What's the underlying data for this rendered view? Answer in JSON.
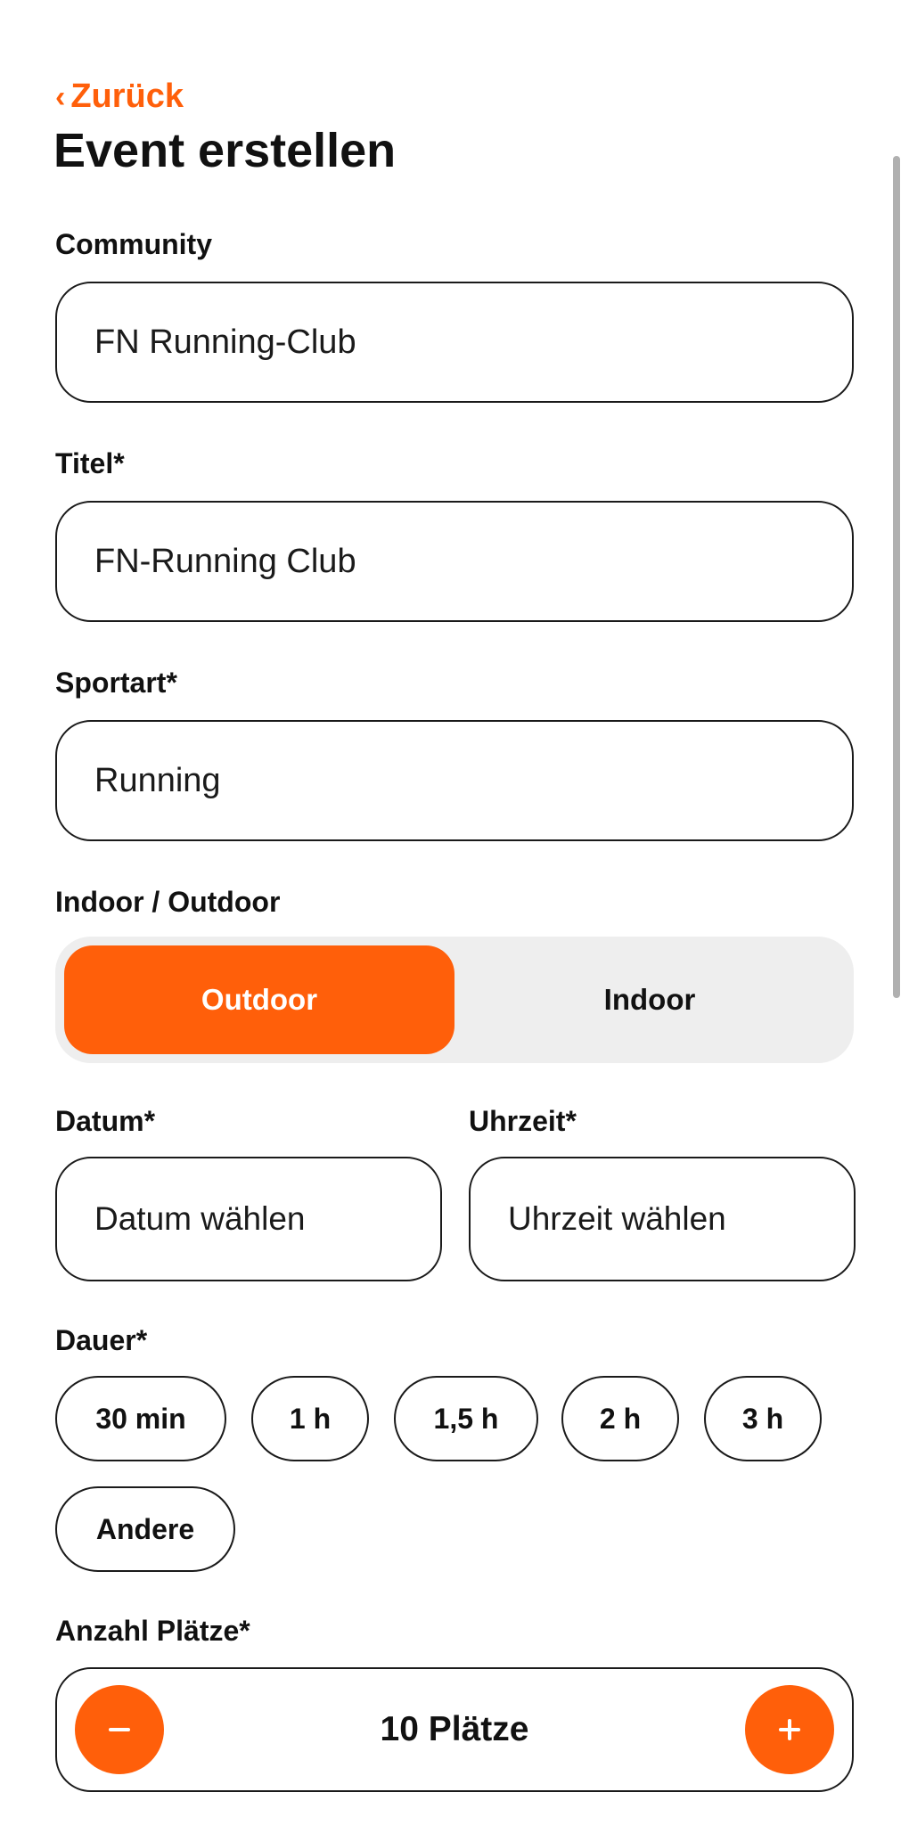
{
  "header": {
    "back_label": "Zurück",
    "title": "Event erstellen"
  },
  "form": {
    "community": {
      "label": "Community",
      "value": "FN Running-Club"
    },
    "title": {
      "label": "Titel*",
      "value": "FN-Running Club"
    },
    "sport": {
      "label": "Sportart*",
      "value": "Running"
    },
    "location_type": {
      "label": "Indoor / Outdoor",
      "options": [
        "Outdoor",
        "Indoor"
      ],
      "selected": "Outdoor"
    },
    "date": {
      "label": "Datum*",
      "placeholder": "Datum wählen"
    },
    "time": {
      "label": "Uhrzeit*",
      "placeholder": "Uhrzeit wählen"
    },
    "duration": {
      "label": "Dauer*",
      "options": [
        "30 min",
        "1 h",
        "1,5 h",
        "2 h",
        "3 h",
        "Andere"
      ]
    },
    "spots": {
      "label": "Anzahl Plätze*",
      "value_text": "10 Plätze",
      "count": 10
    }
  },
  "icons": {
    "back": "chevron-left-icon",
    "minus": "minus-icon",
    "plus": "plus-icon"
  },
  "colors": {
    "accent": "#ff5f0a",
    "border": "#1a1a1a",
    "toggle_bg": "#eeeeee",
    "text": "#111111"
  }
}
